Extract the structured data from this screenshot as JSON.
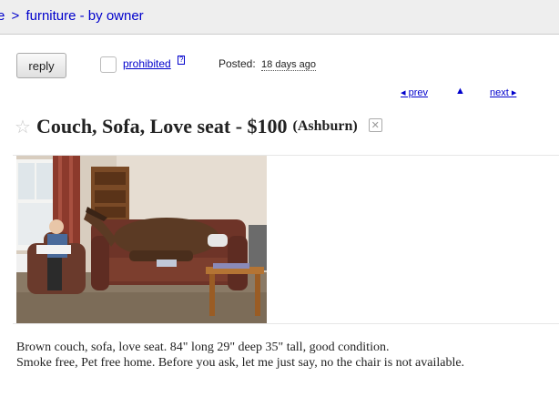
{
  "breadcrumb": {
    "partial_prefix": "e",
    "separator": ">",
    "section": "furniture - by owner"
  },
  "actions": {
    "reply_label": "reply",
    "flag_label": "prohibited",
    "help_label": "?"
  },
  "posted": {
    "label": "Posted:",
    "date": "18 days ago"
  },
  "nav": {
    "prev_label": "◂ prev",
    "up_label": "▲",
    "next_label": "next ▸"
  },
  "posting": {
    "title": "Couch, Sofa, Love seat - $100",
    "location": "(Ashburn)",
    "body_line1": "Brown couch, sofa, love seat. 84\" long 29\" deep 35\" tall, good condition.",
    "body_line2": "Smoke free, Pet free home. Before you ask, let me just say, no the chair is not available."
  },
  "icons": {
    "favorite": "star-icon",
    "hide": "hide-icon"
  },
  "colors": {
    "link": "#0000cc",
    "header_bg": "#eeeeee"
  }
}
